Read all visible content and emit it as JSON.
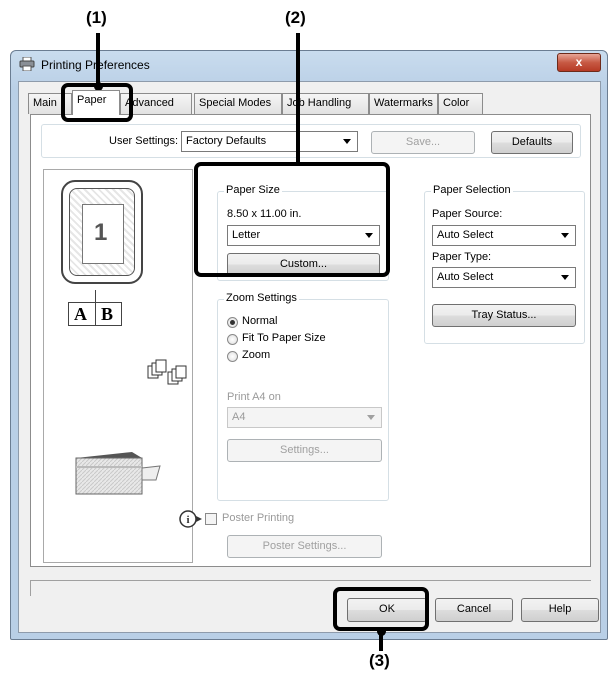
{
  "callouts": {
    "c1": "(1)",
    "c2": "(2)",
    "c3": "(3)"
  },
  "window": {
    "title": "Printing Preferences",
    "close_glyph": "x"
  },
  "tabs": [
    "Main",
    "Paper",
    "Advanced",
    "Special Modes",
    "Job Handling",
    "Watermarks",
    "Color"
  ],
  "user_settings": {
    "label": "User Settings:",
    "value": "Factory Defaults",
    "save_label": "Save...",
    "defaults_label": "Defaults"
  },
  "preview": {
    "page_number": "1",
    "book_left": "A",
    "book_right": "B"
  },
  "paper_size": {
    "title": "Paper Size",
    "dimensions": "8.50 x 11.00 in.",
    "value": "Letter",
    "custom_label": "Custom..."
  },
  "zoom_settings": {
    "title": "Zoom Settings",
    "options": [
      "Normal",
      "Fit To Paper Size",
      "Zoom"
    ],
    "print_on_label": "Print A4 on",
    "print_on_value": "A4",
    "settings_label": "Settings..."
  },
  "paper_selection": {
    "title": "Paper Selection",
    "source_label": "Paper Source:",
    "source_value": "Auto Select",
    "type_label": "Paper Type:",
    "type_value": "Auto Select",
    "tray_status_label": "Tray Status..."
  },
  "poster": {
    "label": "Poster Printing",
    "settings_label": "Poster Settings..."
  },
  "footer": {
    "ok": "OK",
    "cancel": "Cancel",
    "help": "Help"
  }
}
